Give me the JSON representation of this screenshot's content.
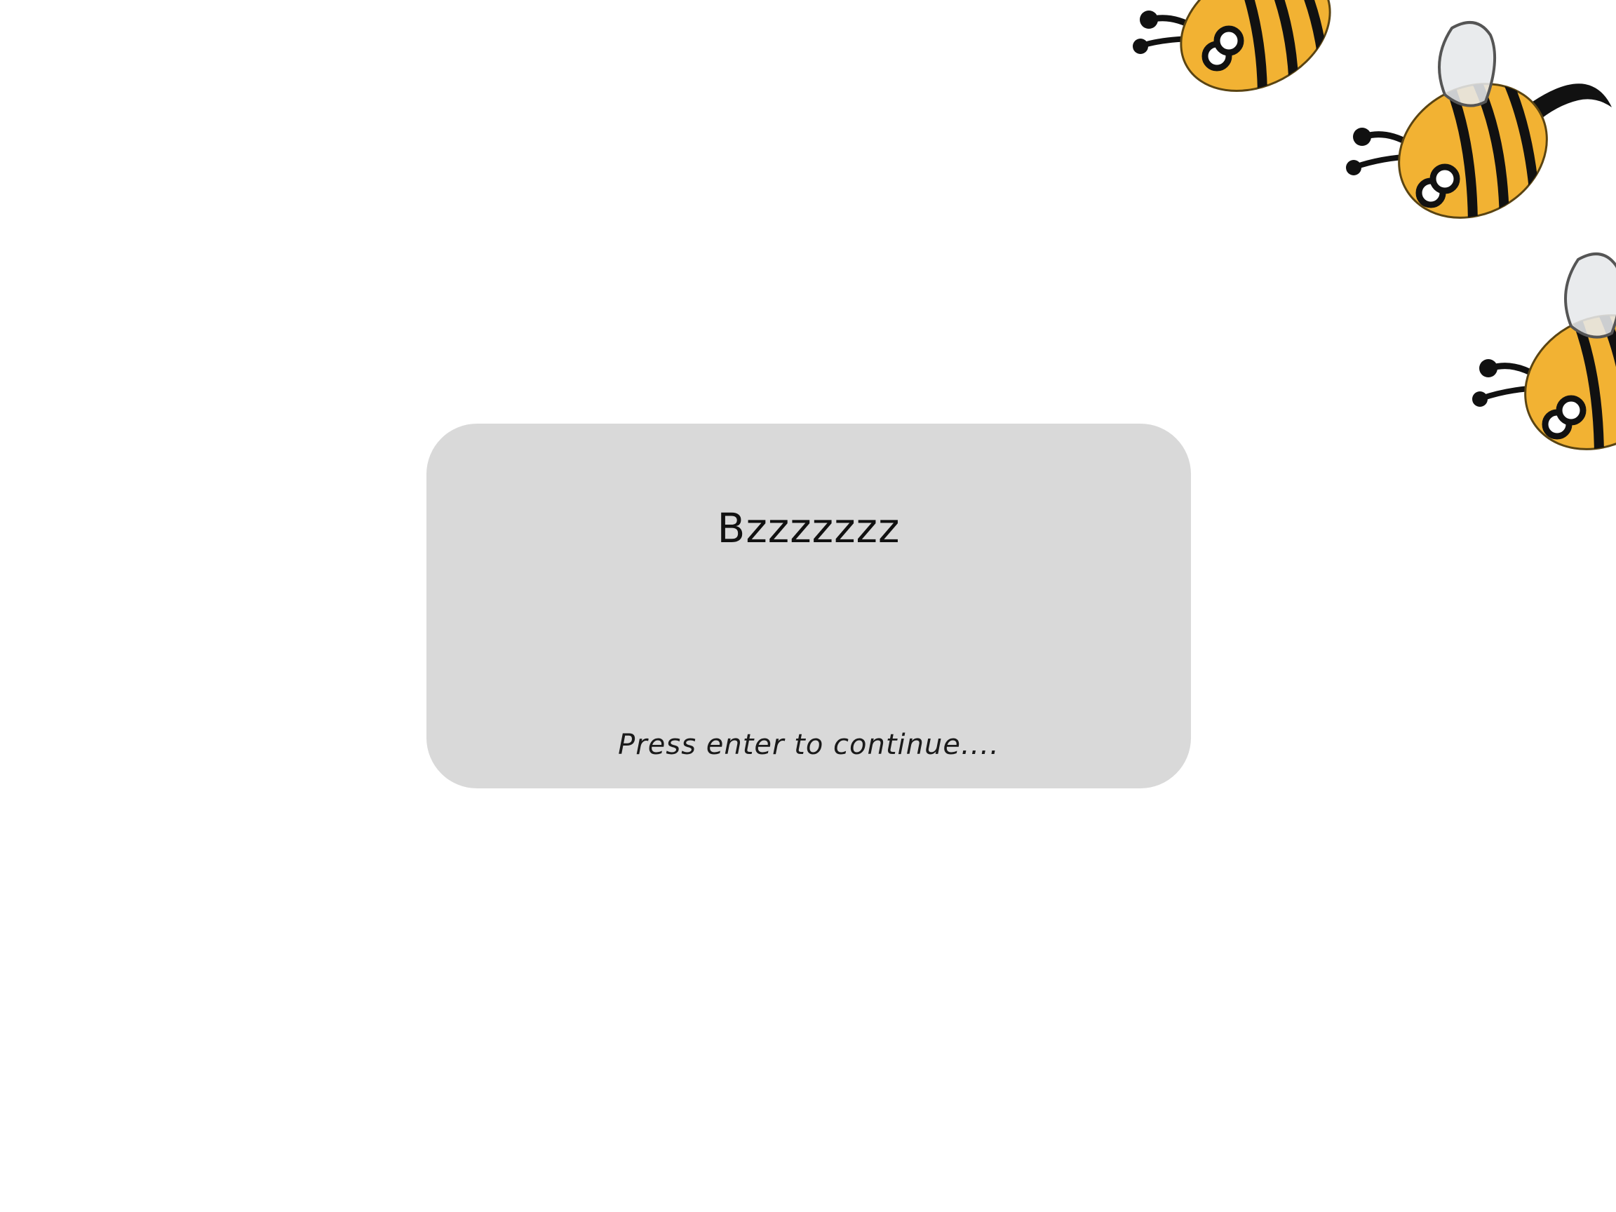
{
  "dialog": {
    "text": "Bzzzzzzz",
    "prompt": "Press enter to continue...."
  },
  "colors": {
    "background": "#ffffff",
    "dialog_background": "#d9d9d9",
    "bee_body": "#f2b233",
    "bee_stripe": "#111111",
    "bee_wing": "#e6e8ea"
  },
  "sprites": {
    "bees": [
      "bee-sprite",
      "bee-sprite",
      "bee-sprite"
    ]
  }
}
